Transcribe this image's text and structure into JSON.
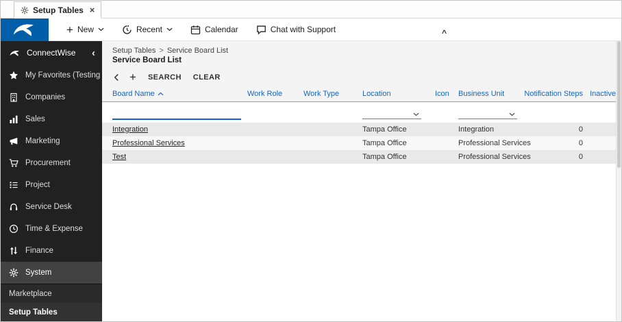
{
  "tab": {
    "title": "Setup Tables"
  },
  "icons": {
    "plus": "+",
    "close": "×",
    "caret_up": "^",
    "chevron_left": "‹",
    "breadcrumb_separator": ">"
  },
  "header": {
    "new_label": "New",
    "recent_label": "Recent",
    "calendar_label": "Calendar",
    "chat_label": "Chat with Support"
  },
  "sidebar": {
    "brand": "ConnectWise",
    "items": [
      {
        "label": "My Favorites (Testing",
        "icon": "star-icon"
      },
      {
        "label": "Companies",
        "icon": "building-icon"
      },
      {
        "label": "Sales",
        "icon": "bar-chart-icon"
      },
      {
        "label": "Marketing",
        "icon": "megaphone-icon"
      },
      {
        "label": "Procurement",
        "icon": "cart-icon"
      },
      {
        "label": "Project",
        "icon": "task-list-icon"
      },
      {
        "label": "Service Desk",
        "icon": "headset-icon"
      },
      {
        "label": "Time & Expense",
        "icon": "clock-icon"
      },
      {
        "label": "Finance",
        "icon": "exchange-icon"
      },
      {
        "label": "System",
        "icon": "gear-icon",
        "active": true
      }
    ],
    "bottom_items": [
      {
        "label": "Marketplace"
      },
      {
        "label": "Setup Tables",
        "active": true
      }
    ]
  },
  "breadcrumb": {
    "parent": "Setup Tables",
    "current": "Service Board List"
  },
  "page": {
    "title": "Service Board List"
  },
  "toolbar": {
    "search_label": "SEARCH",
    "clear_label": "CLEAR"
  },
  "table": {
    "columns": [
      "Board Name",
      "Work Role",
      "Work Type",
      "Location",
      "Icon",
      "Business Unit",
      "Notification Steps",
      "Inactive"
    ],
    "sort": {
      "column": "Board Name",
      "direction": "asc"
    },
    "rows": [
      {
        "board_name": "Integration",
        "work_role": "",
        "work_type": "",
        "location": "Tampa Office",
        "icon": "",
        "business_unit": "Integration",
        "notification_steps": "0",
        "inactive": ""
      },
      {
        "board_name": "Professional Services",
        "work_role": "",
        "work_type": "",
        "location": "Tampa Office",
        "icon": "",
        "business_unit": "Professional Services",
        "notification_steps": "0",
        "inactive": ""
      },
      {
        "board_name": "Test",
        "work_role": "",
        "work_type": "",
        "location": "Tampa Office",
        "icon": "",
        "business_unit": "Professional Services",
        "notification_steps": "0",
        "inactive": ""
      }
    ]
  },
  "colors": {
    "accent_blue": "#1565c0",
    "brand_blue": "#005fa8",
    "sidebar_bg": "#212121"
  }
}
